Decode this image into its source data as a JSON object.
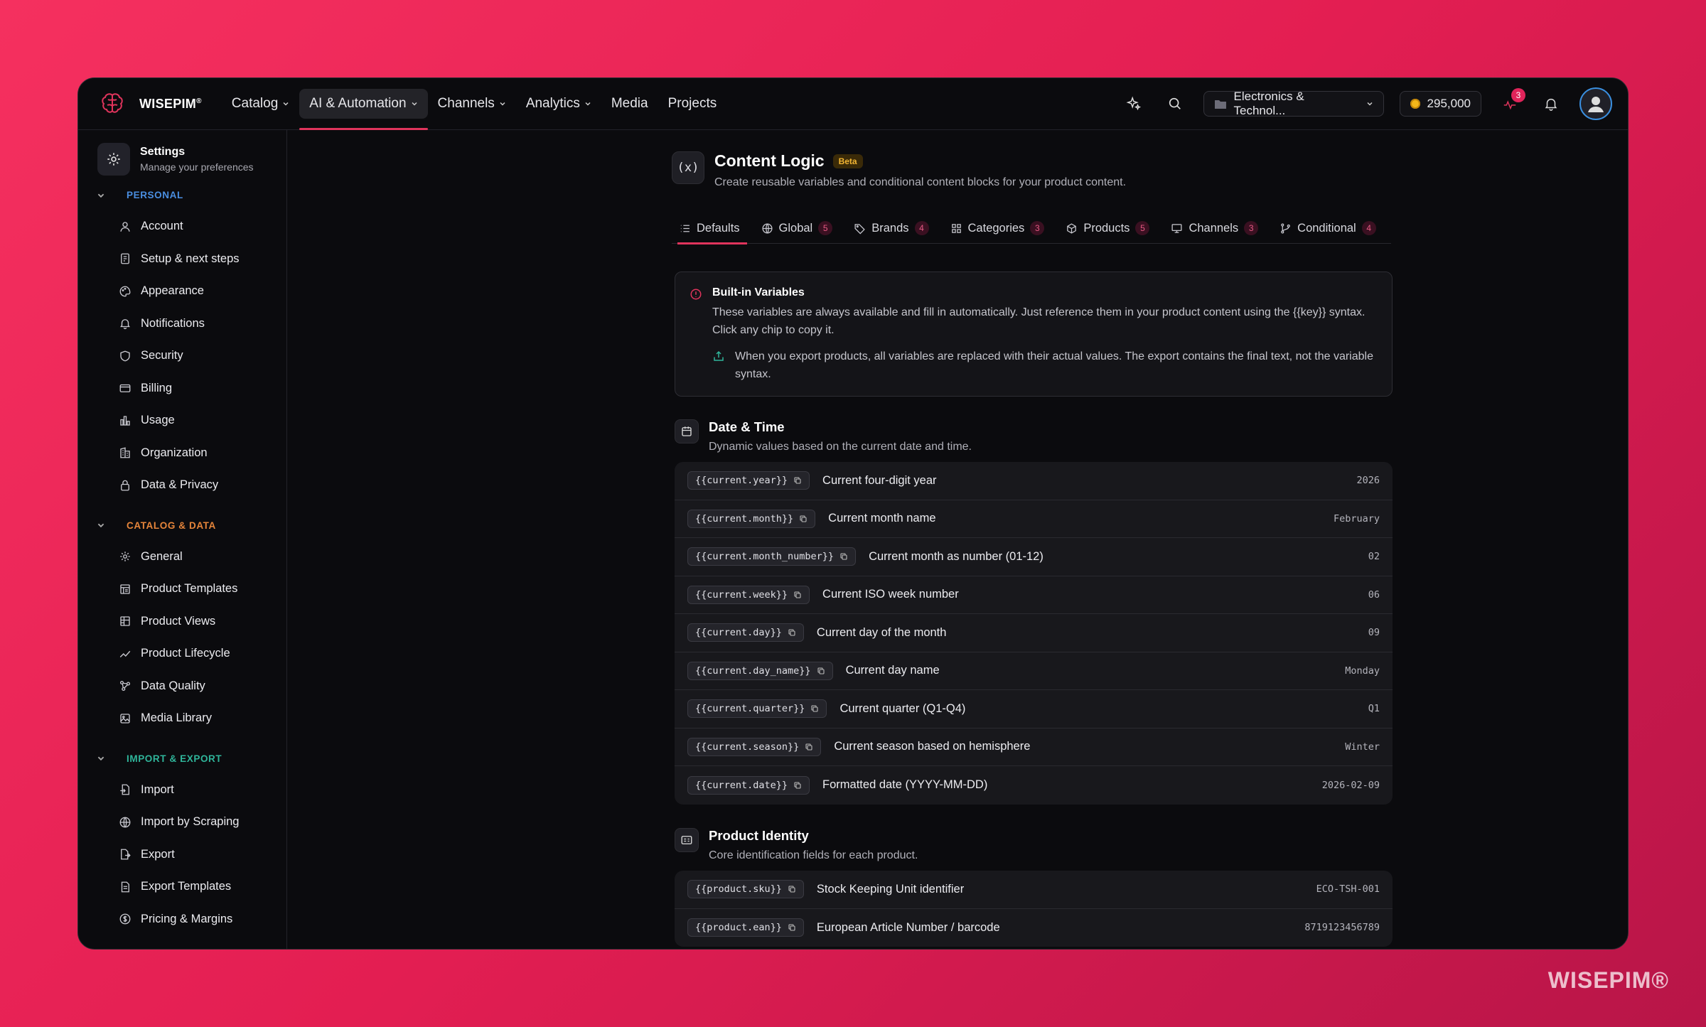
{
  "brand": {
    "name": "WISEPIM",
    "mark": "®"
  },
  "watermark": "WISEPIM®",
  "nav": [
    "Catalog",
    "AI & Automation",
    "Channels",
    "Analytics",
    "Media",
    "Projects"
  ],
  "nav_active": "AI & Automation",
  "store": {
    "label": "Electronics & Technol..."
  },
  "credits": "295,000",
  "notif_badge": "3",
  "settings": {
    "title": "Settings",
    "subtitle": "Manage your preferences"
  },
  "sidebar": {
    "personal": {
      "label": "PERSONAL",
      "color": "#4a8ee0",
      "items": [
        "Account",
        "Setup & next steps",
        "Appearance",
        "Notifications",
        "Security",
        "Billing",
        "Usage",
        "Organization",
        "Data & Privacy"
      ]
    },
    "catalog": {
      "label": "CATALOG & DATA",
      "color": "#e6853a",
      "items": [
        "General",
        "Product Templates",
        "Product Views",
        "Product Lifecycle",
        "Data Quality",
        "Media Library"
      ]
    },
    "import": {
      "label": "IMPORT & EXPORT",
      "color": "#2fb59a",
      "items": [
        "Import",
        "Import by Scraping",
        "Export",
        "Export Templates",
        "Pricing & Margins"
      ]
    }
  },
  "page": {
    "icon": "(x)",
    "title": "Content Logic",
    "badge": "Beta",
    "subtitle": "Create reusable variables and conditional content blocks for your product content."
  },
  "tabs": [
    {
      "label": "Defaults",
      "count": ""
    },
    {
      "label": "Global",
      "count": "5"
    },
    {
      "label": "Brands",
      "count": "4"
    },
    {
      "label": "Categories",
      "count": "3"
    },
    {
      "label": "Products",
      "count": "5"
    },
    {
      "label": "Channels",
      "count": "3"
    },
    {
      "label": "Conditional",
      "count": "4"
    }
  ],
  "info": {
    "title": "Built-in Variables",
    "line1": "These variables are always available and fill in automatically. Just reference them in your product content using the {{key}} syntax. Click any chip to copy it.",
    "line2": "When you export products, all variables are replaced with their actual values. The export contains the final text, not the variable syntax."
  },
  "datetime": {
    "title": "Date & Time",
    "subtitle": "Dynamic values based on the current date and time.",
    "rows": [
      {
        "key": "{{current.year}}",
        "desc": "Current four-digit year",
        "val": "2026"
      },
      {
        "key": "{{current.month}}",
        "desc": "Current month name",
        "val": "February"
      },
      {
        "key": "{{current.month_number}}",
        "desc": "Current month as number (01-12)",
        "val": "02"
      },
      {
        "key": "{{current.week}}",
        "desc": "Current ISO week number",
        "val": "06"
      },
      {
        "key": "{{current.day}}",
        "desc": "Current day of the month",
        "val": "09"
      },
      {
        "key": "{{current.day_name}}",
        "desc": "Current day name",
        "val": "Monday"
      },
      {
        "key": "{{current.quarter}}",
        "desc": "Current quarter (Q1-Q4)",
        "val": "Q1"
      },
      {
        "key": "{{current.season}}",
        "desc": "Current season based on hemisphere",
        "val": "Winter"
      },
      {
        "key": "{{current.date}}",
        "desc": "Formatted date (YYYY-MM-DD)",
        "val": "2026-02-09"
      }
    ]
  },
  "identity": {
    "title": "Product Identity",
    "subtitle": "Core identification fields for each product.",
    "rows": [
      {
        "key": "{{product.sku}}",
        "desc": "Stock Keeping Unit identifier",
        "val": "ECO-TSH-001"
      },
      {
        "key": "{{product.ean}}",
        "desc": "European Article Number / barcode",
        "val": "8719123456789"
      }
    ]
  }
}
